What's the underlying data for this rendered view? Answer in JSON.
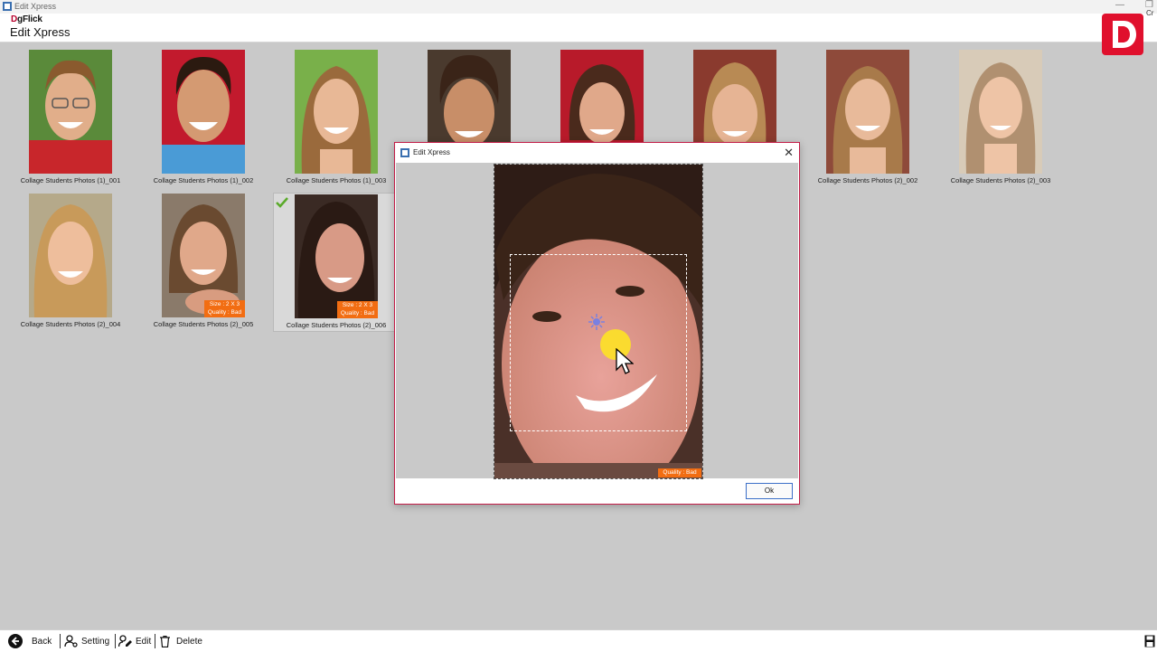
{
  "window": {
    "title": "Edit Xpress"
  },
  "header": {
    "brand_mark": "D",
    "brand_text": "gFlick",
    "title": "Edit Xpress",
    "overflow_text": "Cr"
  },
  "gallery": {
    "photos": [
      {
        "caption": "Collage Students Photos (1)_001",
        "badge_size": "",
        "badge_quality": "",
        "selected": false
      },
      {
        "caption": "Collage Students Photos (1)_002",
        "badge_size": "",
        "badge_quality": "",
        "selected": false
      },
      {
        "caption": "Collage Students Photos (1)_003",
        "badge_size": "",
        "badge_quality": "",
        "selected": false
      },
      {
        "caption": "",
        "badge_size": "",
        "badge_quality": "",
        "selected": false
      },
      {
        "caption": "",
        "badge_size": "",
        "badge_quality": "",
        "selected": false
      },
      {
        "caption": "",
        "badge_size": "",
        "badge_quality": "",
        "selected": false
      },
      {
        "caption": "Collage Students Photos (2)_002",
        "badge_size": "",
        "badge_quality": "",
        "selected": false
      },
      {
        "caption": "Collage Students Photos (2)_003",
        "badge_size": "",
        "badge_quality": "",
        "selected": false
      },
      {
        "caption": "Collage Students Photos (2)_004",
        "badge_size": "",
        "badge_quality": "",
        "selected": false
      },
      {
        "caption": "Collage Students Photos (2)_005",
        "badge_size": "Size : 2 X 3",
        "badge_quality": "Quality : Bad",
        "selected": false
      },
      {
        "caption": "Collage Students Photos (2)_006",
        "badge_size": "Size : 2 X 3",
        "badge_quality": "Quality : Bad",
        "selected": true
      }
    ]
  },
  "dialog": {
    "title": "Edit Xpress",
    "quality_badge": "Quality : Bad",
    "ok_label": "Ok"
  },
  "bottombar": {
    "back_label": "Back",
    "setting_label": "Setting",
    "edit_label": "Edit",
    "delete_label": "Delete"
  },
  "colors": {
    "accent_red": "#e0102d",
    "badge_orange": "#f26d12",
    "background": "#c9c9c9"
  }
}
